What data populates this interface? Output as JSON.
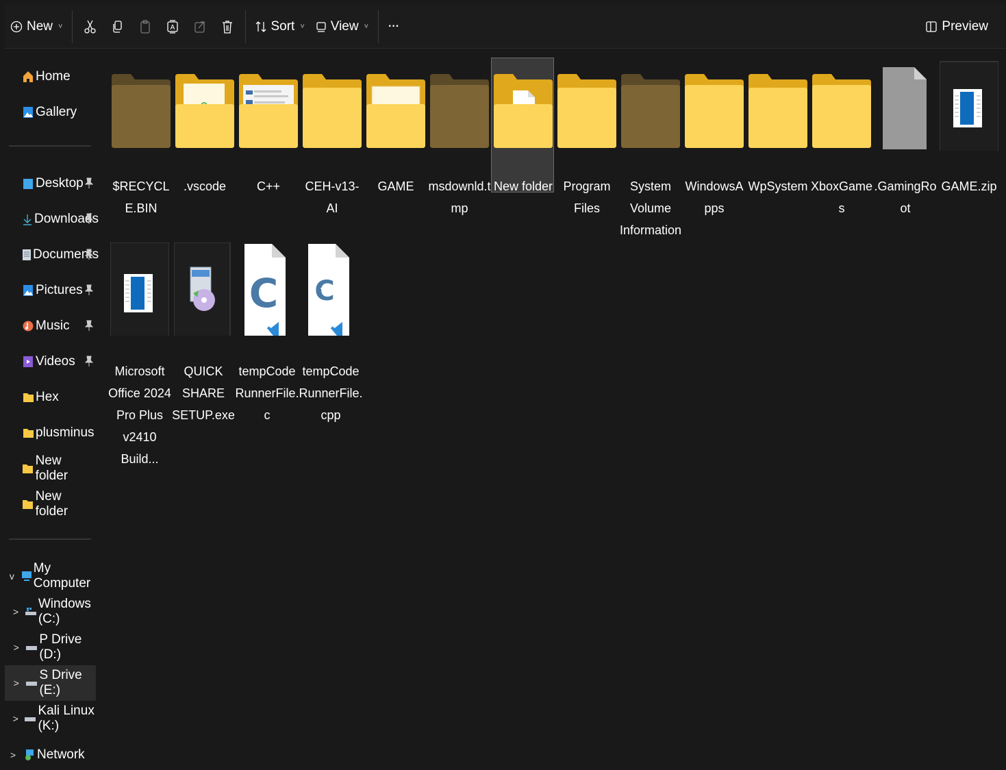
{
  "toolbar": {
    "new_label": "New",
    "sort_label": "Sort",
    "view_label": "View",
    "more_label": "···",
    "preview_label": "Preview",
    "icons": [
      "cut-icon",
      "copy-icon",
      "paste-icon",
      "rename-icon",
      "share-icon",
      "delete-icon"
    ]
  },
  "sidebar": {
    "quick": [
      {
        "label": "Home",
        "icon": "home-icon"
      },
      {
        "label": "Gallery",
        "icon": "gallery-icon"
      }
    ],
    "pinned": [
      {
        "label": "Desktop",
        "icon": "desktop-icon",
        "pinned": true
      },
      {
        "label": "Downloads",
        "icon": "download-icon",
        "pinned": true
      },
      {
        "label": "Documents",
        "icon": "documents-icon",
        "pinned": true
      },
      {
        "label": "Pictures",
        "icon": "pictures-icon",
        "pinned": true
      },
      {
        "label": "Music",
        "icon": "music-icon",
        "pinned": true
      },
      {
        "label": "Videos",
        "icon": "videos-icon",
        "pinned": true
      },
      {
        "label": "Hex",
        "icon": "folder-icon"
      },
      {
        "label": "plusminus",
        "icon": "folder-icon"
      },
      {
        "label": "New folder",
        "icon": "folder-icon"
      },
      {
        "label": "New folder",
        "icon": "folder-icon"
      }
    ],
    "computer": {
      "label": "My Computer",
      "expander": "v"
    },
    "drives": [
      {
        "label": "Windows (C:)",
        "expander": ">"
      },
      {
        "label": "P Drive  (D:)",
        "expander": ">"
      },
      {
        "label": "S Drive (E:)",
        "expander": ">",
        "selected": true
      },
      {
        "label": "Kali Linux (K:)",
        "expander": ">"
      }
    ],
    "network": {
      "label": "Network",
      "expander": ">"
    }
  },
  "files": [
    {
      "name": "$RECYCLE.BIN",
      "type": "folder-dim"
    },
    {
      "name": ".vscode",
      "type": "folder-doc"
    },
    {
      "name": "C++",
      "type": "folder-screenshot"
    },
    {
      "name": "CEH-v13-AI",
      "type": "folder-open"
    },
    {
      "name": "GAME",
      "type": "folder-image"
    },
    {
      "name": "msdownld.tmp",
      "type": "folder-dim"
    },
    {
      "name": "New folder",
      "type": "folder-page",
      "selected": true
    },
    {
      "name": "Program Files",
      "type": "folder-open"
    },
    {
      "name": "System Volume Information",
      "type": "folder-dim"
    },
    {
      "name": "WindowsApps",
      "type": "folder"
    },
    {
      "name": "WpSystem",
      "type": "folder-open"
    },
    {
      "name": "XboxGames",
      "type": "folder"
    },
    {
      "name": ".GamingRoot",
      "type": "file-generic"
    },
    {
      "name": "GAME.zip",
      "type": "file-zip"
    },
    {
      "name": "Microsoft Office 2024 Pro Plus v2410 Build...",
      "type": "file-zip"
    },
    {
      "name": "QUICK SHARE SETUP.exe",
      "type": "file-exe"
    },
    {
      "name": "tempCodeRunnerFile.c",
      "type": "file-c"
    },
    {
      "name": "tempCodeRunnerFile.cpp",
      "type": "file-cpp"
    }
  ],
  "colors": {
    "background": "#191919",
    "folder": "#fcd55a",
    "folder_back": "#e0a81c",
    "folder_dim": "#7d6535",
    "accent": "#0f6cbd"
  }
}
